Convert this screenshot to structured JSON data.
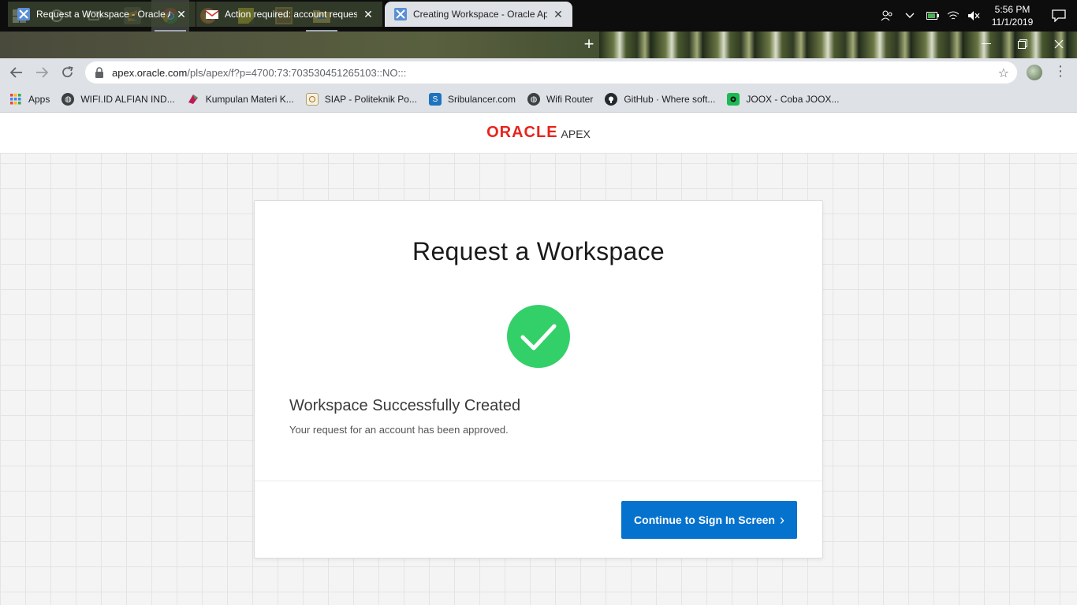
{
  "taskbar": {
    "apps": [
      "start-icon",
      "cortana-icon",
      "task-view-icon",
      "sublime-text-icon",
      "chrome-icon",
      "firefox-icon",
      "sticky-notes-icon",
      "dosbox-icon",
      "file-explorer-icon"
    ],
    "clock_time": "5:56 PM",
    "clock_date": "11/1/2019"
  },
  "tabs": [
    {
      "title": "Request a Workspace - Oracle Ap",
      "state": "inactive"
    },
    {
      "title": "Action required: account request",
      "state": "inactive"
    },
    {
      "title": "Creating Workspace - Oracle App",
      "state": "active"
    }
  ],
  "toolbar": {
    "url_domain": "apex.oracle.com",
    "url_path": "/pls/apex/f?p=4700:73:703530451265103::NO:::"
  },
  "bookmarks": [
    {
      "label": "Apps",
      "icon": "apps-grid-icon"
    },
    {
      "label": "WIFI.ID ALFIAN IND...",
      "icon": "globe-icon"
    },
    {
      "label": "Kumpulan Materi K...",
      "icon": "materi-icon"
    },
    {
      "label": "SIAP - Politeknik Po...",
      "icon": "siap-icon"
    },
    {
      "label": "Sribulancer.com",
      "icon": "sribulancer-icon"
    },
    {
      "label": "Wifi Router",
      "icon": "globe-icon"
    },
    {
      "label": "GitHub · Where soft...",
      "icon": "github-icon"
    },
    {
      "label": "JOOX - Coba JOOX...",
      "icon": "joox-icon"
    }
  ],
  "header": {
    "brand": "ORACLE",
    "product": "APEX"
  },
  "card": {
    "title": "Request a Workspace",
    "status_title": "Workspace Successfully Created",
    "status_message": "Your request for an account has been approved.",
    "button_label": "Continue to Sign In Screen"
  },
  "colors": {
    "oracle_red": "#e8241c",
    "success_green": "#33d069",
    "button_blue": "#0572ce"
  }
}
